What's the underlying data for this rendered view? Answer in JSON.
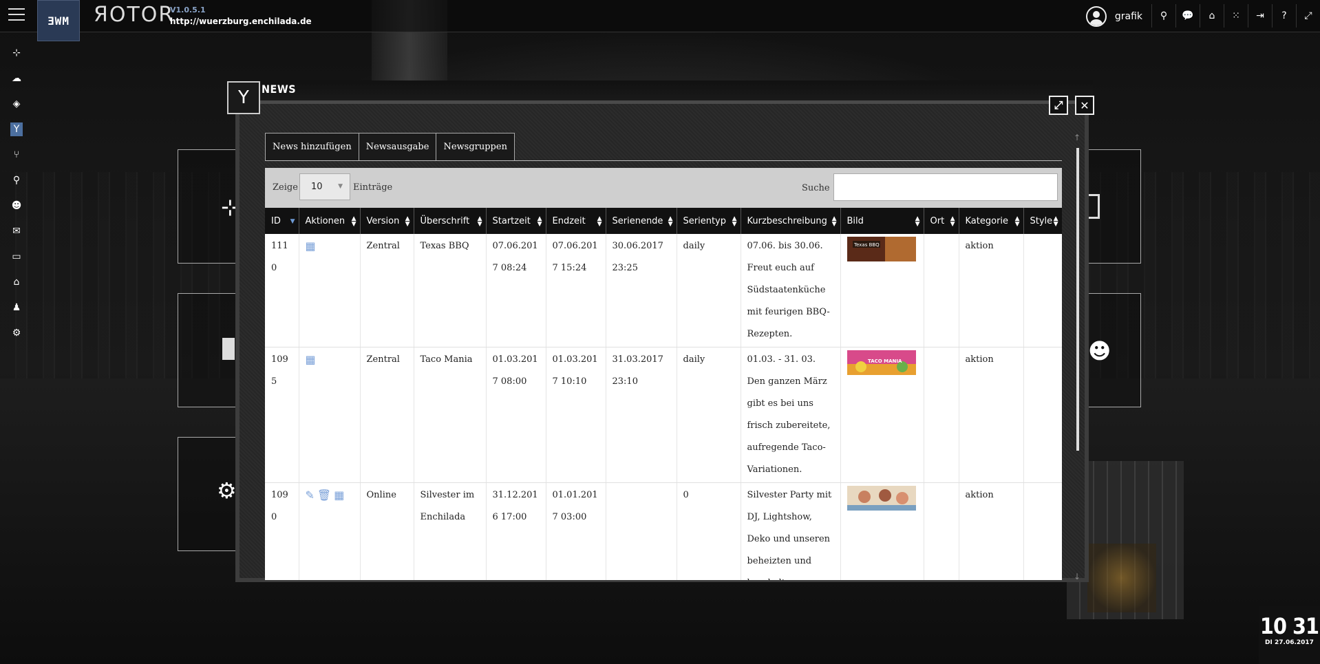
{
  "header": {
    "logo_text": "ƎWM",
    "app_name": "ЯOTOR",
    "version": "V1.0.5.1",
    "url": "http://wuerzburg.enchilada.de",
    "username": "grafik",
    "icons": [
      "search-icon",
      "chat-icon",
      "home-icon",
      "spinner-icon",
      "logout-icon",
      "help-icon",
      "fullscreen-icon"
    ]
  },
  "sidebar": {
    "items": [
      {
        "name": "sitemap-icon",
        "glyph": "⊹"
      },
      {
        "name": "cloud-icon",
        "glyph": "☁"
      },
      {
        "name": "cube-icon",
        "glyph": "◈"
      },
      {
        "name": "cocktail-icon",
        "glyph": "Y",
        "active": true
      },
      {
        "name": "cutlery-icon",
        "glyph": "⑂"
      },
      {
        "name": "map-marker-icon",
        "glyph": "⚲"
      },
      {
        "name": "users-icon",
        "glyph": "☻"
      },
      {
        "name": "envelope-icon",
        "glyph": "✉"
      },
      {
        "name": "archive-icon",
        "glyph": "▭"
      },
      {
        "name": "home-icon",
        "glyph": "⌂"
      },
      {
        "name": "user-icon",
        "glyph": "♟"
      },
      {
        "name": "cogs-icon",
        "glyph": "⚙"
      }
    ]
  },
  "modal": {
    "title": "NEWS",
    "icon": "cocktail-icon",
    "tabs": [
      "News hinzufügen",
      "Newsausgabe",
      "Newsgruppen"
    ],
    "filter": {
      "zeige": "Zeige",
      "page_size": "10",
      "eintraege": "Einträge",
      "suche": "Suche",
      "search_value": ""
    },
    "columns": [
      "ID",
      "Aktionen",
      "Version",
      "Überschrift",
      "Startzeit",
      "Endzeit",
      "Serienende",
      "Serientyp",
      "Kurzbeschreibung",
      "Bild",
      "Ort",
      "Kategorie",
      "Style"
    ],
    "rows": [
      {
        "id": "1110",
        "actions": [
          "calendar-icon"
        ],
        "version": "Zentral",
        "ueberschrift": "Texas BBQ",
        "startzeit": "07.06.2017 08:24",
        "endzeit": "07.06.2017 15:24",
        "serienende": "30.06.2017 23:25",
        "serientyp": "daily",
        "kurz": "07.06. bis 30.06. Freut euch auf Südstaatenküche mit feurigen BBQ-Rezepten.",
        "bild": "Texas BBQ",
        "ort": "",
        "kategorie": "aktion",
        "style": ""
      },
      {
        "id": "1095",
        "actions": [
          "calendar-icon"
        ],
        "version": "Zentral",
        "ueberschrift": "Taco Mania",
        "startzeit": "01.03.2017 08:00",
        "endzeit": "01.03.2017 10:10",
        "serienende": "31.03.2017 23:10",
        "serientyp": "daily",
        "kurz": "01.03. - 31. 03. Den ganzen März gibt es bei uns frisch zubereitete, aufregende Taco-Variationen.",
        "bild": "TACO MANIA",
        "ort": "",
        "kategorie": "aktion",
        "style": ""
      },
      {
        "id": "1090",
        "actions": [
          "edit-icon",
          "trash-icon",
          "calendar-icon"
        ],
        "version": "Online",
        "ueberschrift": "Silvester im Enchilada",
        "startzeit": "31.12.2016 17:00",
        "endzeit": "01.01.2017 03:00",
        "serienende": "",
        "serientyp": "0",
        "kurz": "Silvester Party mit DJ, Lightshow, Deko und unseren beheizten und beschalter",
        "bild": "",
        "ort": "",
        "kategorie": "aktion",
        "style": ""
      }
    ]
  },
  "clock": {
    "time": "10 31",
    "date": "DI 27.06.2017"
  },
  "colors": {
    "accent": "#4c6f9f",
    "action_icon": "#7aa0d8"
  }
}
